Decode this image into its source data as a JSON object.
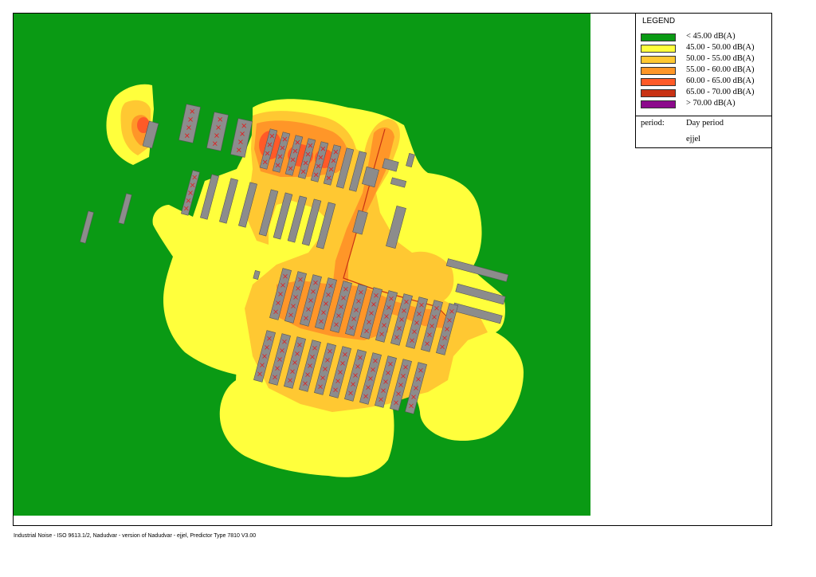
{
  "legend": {
    "title": "LEGEND",
    "entries": [
      {
        "label": "< 45.00 dB(A)",
        "color": "#0a9a14"
      },
      {
        "label": "45.00 - 50.00 dB(A)",
        "color": "#ffff3c"
      },
      {
        "label": "50.00 - 55.00 dB(A)",
        "color": "#ffc832"
      },
      {
        "label": "55.00 - 60.00 dB(A)",
        "color": "#ff9628"
      },
      {
        "label": "60.00 - 65.00 dB(A)",
        "color": "#ff5a28"
      },
      {
        "label": "65.00 - 70.00 dB(A)",
        "color": "#c83214"
      },
      {
        "label": "> 70.00 dB(A)",
        "color": "#8c0a8c"
      }
    ],
    "period_label": "period:",
    "period_value": "Day period",
    "period_sub": "ejjel"
  },
  "map": {
    "background_color": "#0a9a14",
    "building_color": "#8c8c8c",
    "source_marker_color": "#e01e1e"
  },
  "footer": {
    "text": "Industrial Noise - ISO 9613.1/2, Nadudvar - version of Nadudvar - ejjel, Predictor Type 7810 V3.00"
  }
}
